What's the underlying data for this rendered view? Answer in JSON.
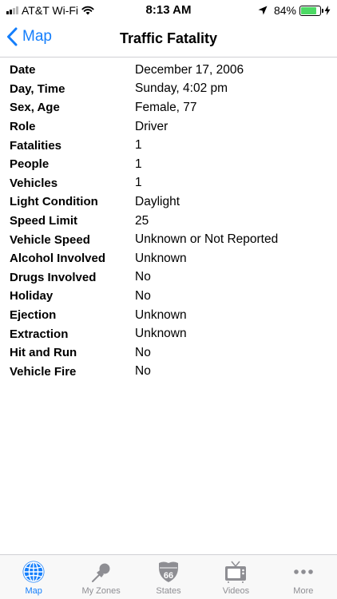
{
  "status_bar": {
    "carrier": "AT&T Wi-Fi",
    "time": "8:13 AM",
    "battery_percent": "84%",
    "battery_level": 0.84,
    "battery_color": "#4cd964"
  },
  "nav": {
    "back_label": "Map",
    "title": "Traffic Fatality",
    "accent_color": "#147efb"
  },
  "details": [
    {
      "label": "Date",
      "value": "December 17, 2006"
    },
    {
      "label": "Day, Time",
      "value": "Sunday, 4:02 pm"
    },
    {
      "label": "Sex, Age",
      "value": "Female, 77"
    },
    {
      "label": "Role",
      "value": "Driver"
    },
    {
      "label": "Fatalities",
      "value": "1"
    },
    {
      "label": "People",
      "value": "1"
    },
    {
      "label": "Vehicles",
      "value": "1"
    },
    {
      "label": "Light Condition",
      "value": "Daylight"
    },
    {
      "label": "Speed Limit",
      "value": "25"
    },
    {
      "label": "Vehicle Speed",
      "value": "Unknown or Not Reported"
    },
    {
      "label": "Alcohol Involved",
      "value": "Unknown"
    },
    {
      "label": "Drugs Involved",
      "value": "No"
    },
    {
      "label": "Holiday",
      "value": "No"
    },
    {
      "label": "Ejection",
      "value": "Unknown"
    },
    {
      "label": "Extraction",
      "value": "Unknown"
    },
    {
      "label": "Hit and Run",
      "value": "No"
    },
    {
      "label": "Vehicle Fire",
      "value": "No"
    }
  ],
  "tabs": [
    {
      "label": "Map",
      "icon": "globe-icon",
      "active": true
    },
    {
      "label": "My Zones",
      "icon": "pushpin-icon",
      "active": false
    },
    {
      "label": "States",
      "icon": "route-66-shield-icon",
      "active": false,
      "icon_text": "66"
    },
    {
      "label": "Videos",
      "icon": "tv-icon",
      "active": false
    },
    {
      "label": "More",
      "icon": "more-dots-icon",
      "active": false
    }
  ]
}
